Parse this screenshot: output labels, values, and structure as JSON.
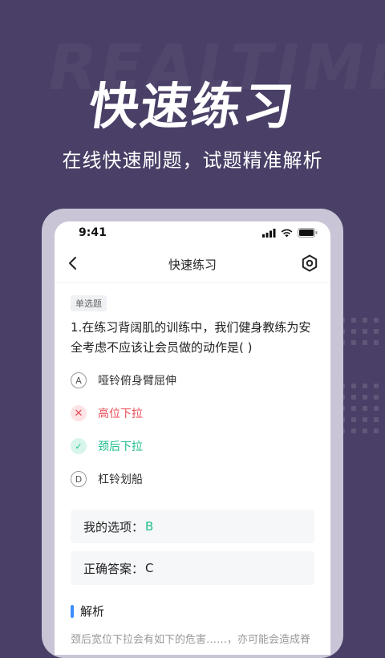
{
  "hero": {
    "title": "快速练习",
    "subtitle": "在线快速刷题，试题精准解析",
    "watermark": "REALTIME"
  },
  "phone": {
    "status_time": "9:41",
    "nav_title": "快速练习",
    "question": {
      "tag": "单选题",
      "text": "1.在练习背阔肌的训练中，我们健身教练为安全考虑不应该让会员做的动作是( )"
    },
    "options": [
      {
        "badge": "A",
        "label": "哑铃俯身臂屈伸",
        "state": "normal"
      },
      {
        "badge": "✕",
        "label": "高位下拉",
        "state": "wrong"
      },
      {
        "badge": "✓",
        "label": "颈后下拉",
        "state": "correct"
      },
      {
        "badge": "D",
        "label": "杠铃划船",
        "state": "normal"
      }
    ],
    "my_answer_label": "我的选项：",
    "my_answer_value": "B",
    "correct_answer_label": "正确答案：",
    "correct_answer_value": "C",
    "analysis_title": "解析",
    "analysis_text": "颈后宽位下拉会有如下的危害……，亦可能会造成脊"
  },
  "colors": {
    "background": "#4a3f66",
    "wrong": "#e94b55",
    "correct": "#1fbe8e",
    "accent": "#3c8dff"
  }
}
